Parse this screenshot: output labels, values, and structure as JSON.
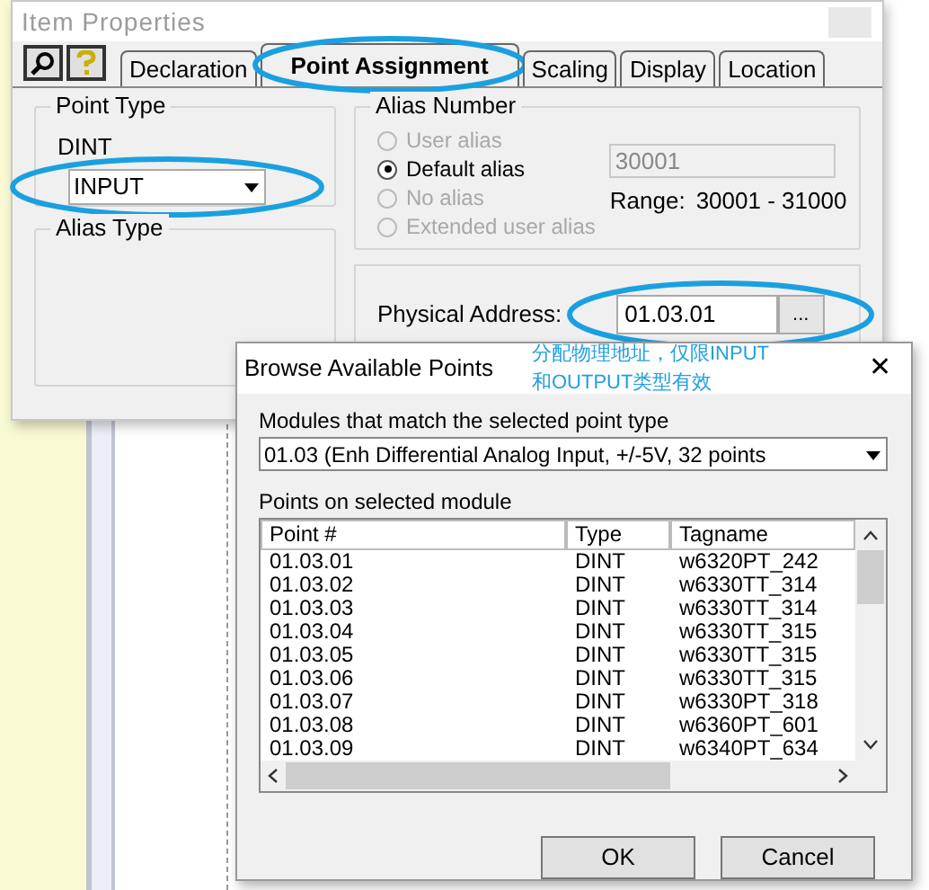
{
  "item_window": {
    "title": "Item Properties",
    "tabs": [
      {
        "label": "Declaration",
        "selected": false
      },
      {
        "label": "Point Assignment",
        "selected": true
      },
      {
        "label": "Scaling",
        "selected": false
      },
      {
        "label": "Display",
        "selected": false
      },
      {
        "label": "Location",
        "selected": false
      }
    ],
    "point_type": {
      "title": "Point Type",
      "data_type": "DINT",
      "select_value": "INPUT"
    },
    "alias_type": {
      "title": "Alias Type"
    },
    "alias_number": {
      "title": "Alias Number",
      "options": [
        {
          "label": "User alias",
          "selected": false,
          "disabled": true
        },
        {
          "label": "Default alias",
          "selected": true,
          "disabled": false
        },
        {
          "label": "No alias",
          "selected": false,
          "disabled": true
        },
        {
          "label": "Extended user alias",
          "selected": false,
          "disabled": true
        }
      ],
      "alias_value": "30001",
      "range_label": "Range:",
      "range_value": "30001 - 31000"
    },
    "physical_address": {
      "label": "Physical Address:",
      "value": "01.03.01",
      "browse_button": "..."
    }
  },
  "annotation_note": [
    "分配物理地址，仅限INPUT",
    "和OUTPUT类型有效"
  ],
  "browse_dialog": {
    "title": "Browse Available Points",
    "close": "✕",
    "modules_label": "Modules that match the selected point type",
    "module_value": "01.03 (Enh Differential Analog Input, +/-5V, 32 points",
    "points_label": "Points on selected module",
    "columns": [
      "Point #",
      "Type",
      "Tagname"
    ],
    "rows": [
      [
        "01.03.01",
        "DINT",
        "w6320PT_242"
      ],
      [
        "01.03.02",
        "DINT",
        "w6330TT_314"
      ],
      [
        "01.03.03",
        "DINT",
        "w6330TT_314"
      ],
      [
        "01.03.04",
        "DINT",
        "w6330TT_315"
      ],
      [
        "01.03.05",
        "DINT",
        "w6330TT_315"
      ],
      [
        "01.03.06",
        "DINT",
        "w6330TT_315"
      ],
      [
        "01.03.07",
        "DINT",
        "w6330PT_318"
      ],
      [
        "01.03.08",
        "DINT",
        "w6360PT_601"
      ],
      [
        "01.03.09",
        "DINT",
        "w6340PT_634"
      ]
    ],
    "buttons": [
      "OK",
      "Cancel"
    ]
  }
}
